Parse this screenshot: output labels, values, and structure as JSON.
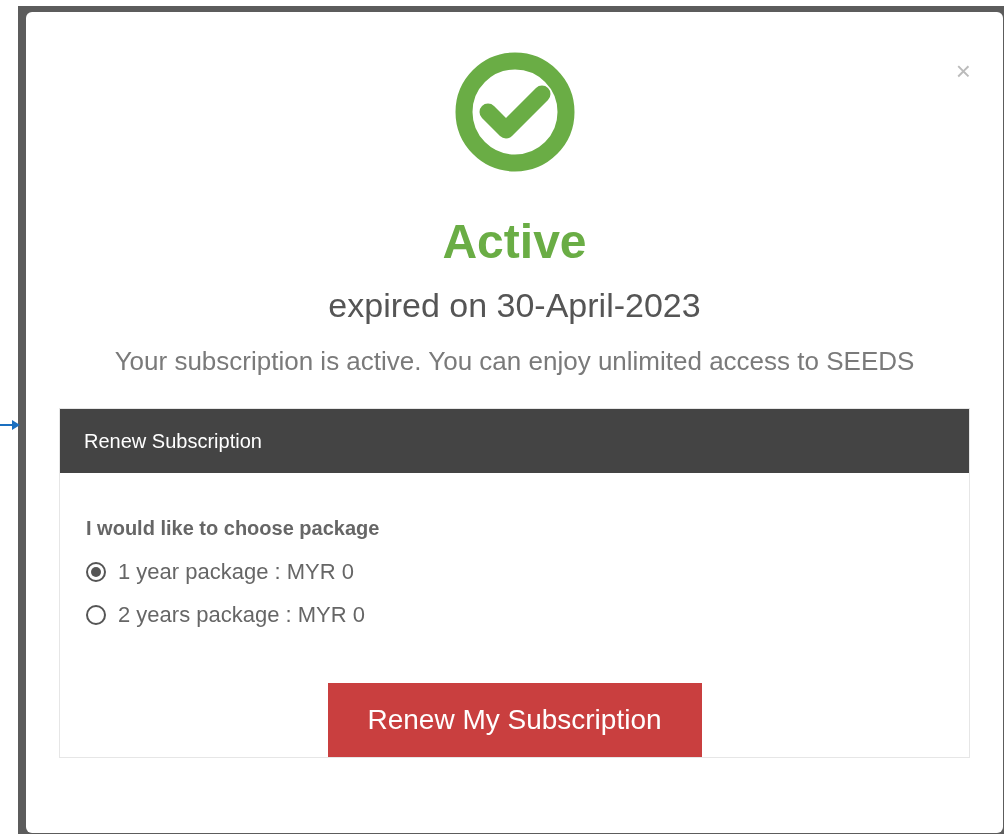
{
  "modal": {
    "status": "Active",
    "expiry": "expired on 30-April-2023",
    "message": "Your subscription is active. You can enjoy unlimited access to SEEDS",
    "close": "×"
  },
  "panel": {
    "title": "Renew Subscription",
    "prompt": "I would like to choose package",
    "packages": [
      {
        "label": "1 year package : MYR 0",
        "selected": true
      },
      {
        "label": "2 years package : MYR 0",
        "selected": false
      }
    ],
    "button": "Renew My Subscription"
  }
}
